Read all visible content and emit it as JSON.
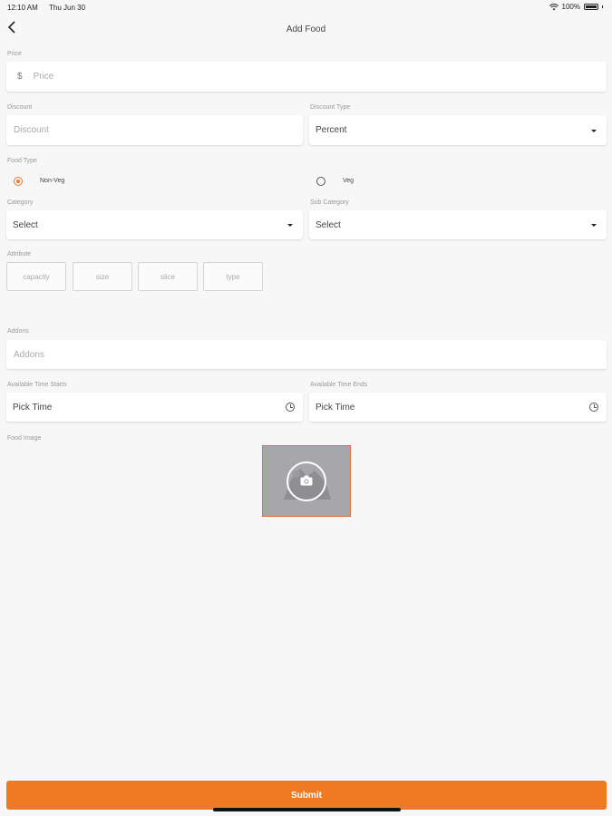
{
  "status_bar": {
    "time": "12:10 AM",
    "date": "Thu Jun 30",
    "battery": "100%"
  },
  "nav": {
    "title": "Add Food",
    "back_icon": "chevron-left-icon"
  },
  "price": {
    "label": "Price",
    "currency_symbol": "$",
    "placeholder": "Price"
  },
  "discount": {
    "label": "Discount",
    "placeholder": "Discount"
  },
  "discount_type": {
    "label": "Discount Type",
    "value": "Percent"
  },
  "food_type": {
    "label": "Food Type",
    "options": [
      {
        "label": "Non-Veg",
        "selected": true
      },
      {
        "label": "Veg",
        "selected": false
      }
    ]
  },
  "category": {
    "label": "Category",
    "value": "Select"
  },
  "sub_category": {
    "label": "Sub Category",
    "value": "Select"
  },
  "attribute": {
    "label": "Attribute",
    "chips": [
      "capacity",
      "size",
      "slice",
      "type"
    ]
  },
  "addons": {
    "label": "Addons",
    "placeholder": "Addons"
  },
  "time_start": {
    "label": "Available Time Starts",
    "value": "Pick Time",
    "icon": "clock-icon"
  },
  "time_end": {
    "label": "Available Time Ends",
    "value": "Pick Time",
    "icon": "clock-icon"
  },
  "food_image": {
    "label": "Food Image",
    "icon": "camera-icon"
  },
  "submit": {
    "label": "Submit"
  },
  "colors": {
    "accent": "#f07a23",
    "background": "#f7f7f7",
    "image_placeholder": "#a7a7a9"
  }
}
